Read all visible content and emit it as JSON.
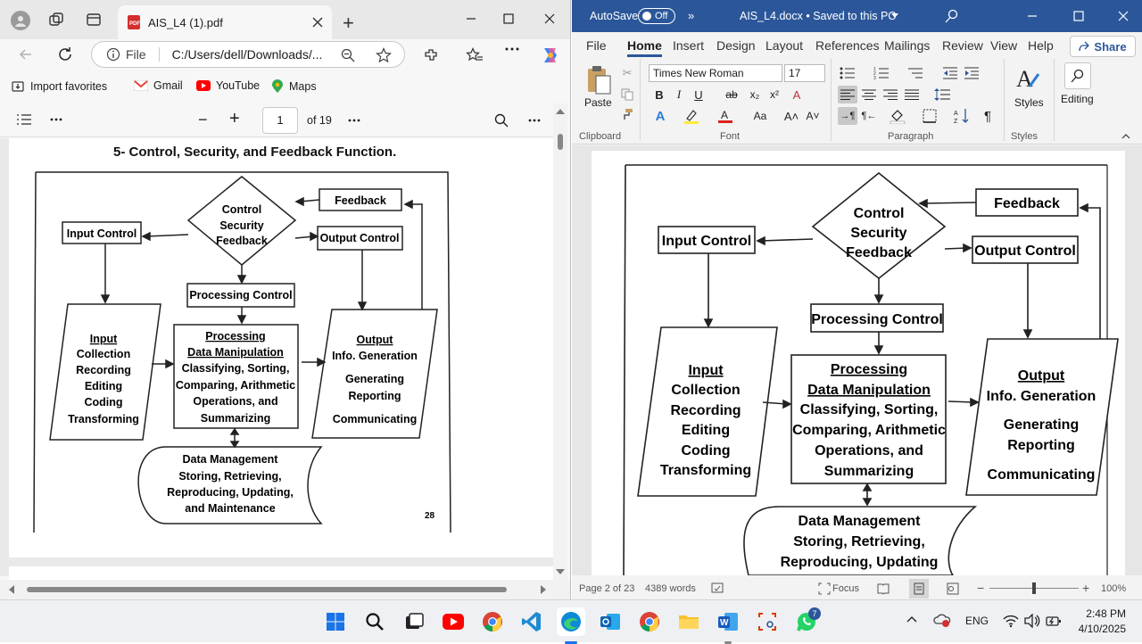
{
  "edge": {
    "tab_title": "AIS_L4 (1).pdf",
    "new_tab": "+",
    "url_prefix": "File",
    "url": "C:/Users/dell/Downloads/...",
    "favorites": [
      "Import favorites",
      "Gmail",
      "YouTube",
      "Maps"
    ],
    "pdf_toolbar": {
      "page_number": "1",
      "page_count": "of 19",
      "minus": "−",
      "plus": "+"
    },
    "heading": "5-  Control, Security, and Feedback Function.",
    "page_footer": "28"
  },
  "word": {
    "autosave_label": "AutoSave",
    "autosave_state": "Off",
    "title": "AIS_L4.docx  •  Saved to this PC",
    "menu": [
      "File",
      "Home",
      "Insert",
      "Design",
      "Layout",
      "References",
      "Mailings",
      "Review",
      "View",
      "Help"
    ],
    "share": "Share",
    "font_name": "Times New Roman",
    "font_size": "17",
    "groups": [
      "Clipboard",
      "Font",
      "Paragraph",
      "Styles"
    ],
    "paste_label": "Paste",
    "styles_label": "Styles",
    "editing_label": "Editing",
    "status": {
      "page": "Page 2 of 23",
      "words": "4389 words",
      "focus": "Focus",
      "zoom": "100%"
    }
  },
  "flowchart": {
    "feedback": "Feedback",
    "control_lines": [
      "Control",
      "Security",
      "Feedback"
    ],
    "input_control": "Input Control",
    "output_control": "Output Control",
    "processing_control": "Processing Control",
    "input_lines": [
      "Input",
      "Collection",
      "Recording",
      "Editing",
      "Coding",
      "Transforming"
    ],
    "processing_lines": [
      "Processing",
      "Data Manipulation",
      "Classifying, Sorting,",
      "Comparing, Arithmetic",
      "Operations, and",
      "Summarizing"
    ],
    "output_lines": [
      "Output",
      "Info. Generation",
      "Generating",
      "Reporting",
      "Communicating"
    ],
    "data_mgmt_lines": [
      "Data Management",
      "Storing, Retrieving,",
      "Reproducing, Updating,",
      "and Maintenance"
    ],
    "data_mgmt_lines_word": [
      "Data Management",
      "Storing, Retrieving,",
      "Reproducing, Updating"
    ]
  },
  "taskbar": {
    "language": "ENG",
    "time": "2:48 PM",
    "date": "4/10/2025",
    "whatsapp_badge": "7"
  }
}
